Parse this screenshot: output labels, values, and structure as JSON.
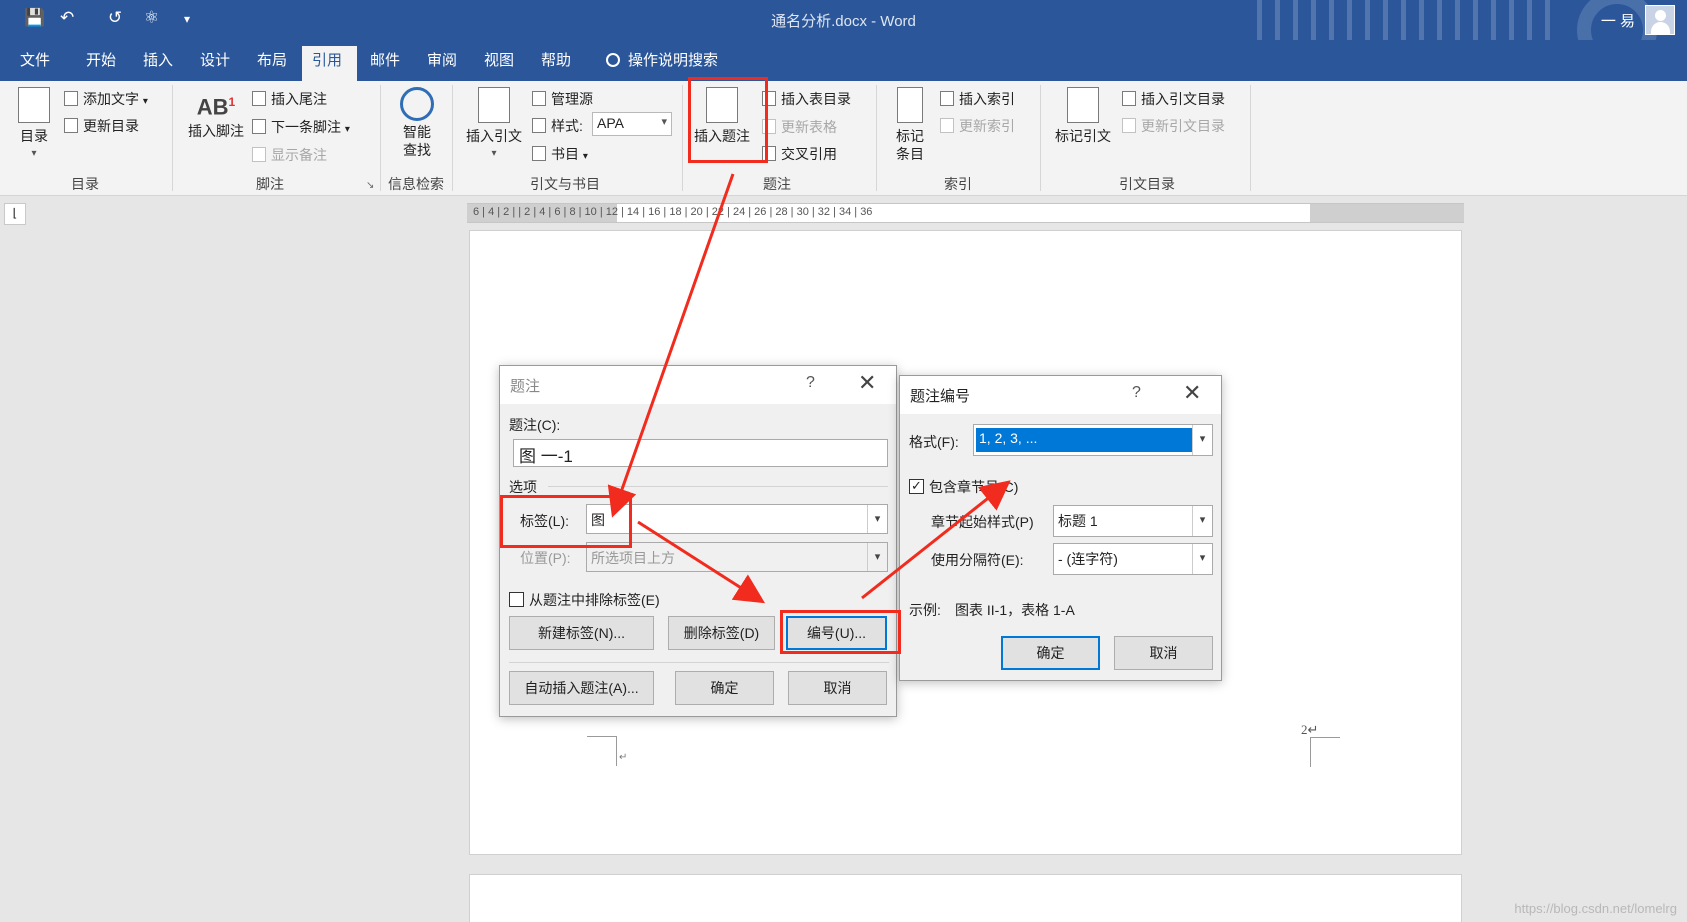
{
  "window": {
    "title": "通名分析.docx  -  Word",
    "user": "一 易",
    "qat": [
      "save-icon",
      "undo-icon",
      "redo-icon",
      "org-chart-icon",
      "customize-icon"
    ]
  },
  "tabs": [
    "文件",
    "开始",
    "插入",
    "设计",
    "布局",
    "引用",
    "邮件",
    "审阅",
    "视图",
    "帮助",
    "操作说明搜索"
  ],
  "active_tab": "引用",
  "ribbon": {
    "toc": {
      "big": "目录",
      "add_text": "添加文字",
      "update": "更新目录",
      "group": "目录"
    },
    "footnote": {
      "insert_footnote": "插入脚注",
      "insert_endnote": "插入尾注",
      "next_footnote": "下一条脚注",
      "show_notes": "显示备注",
      "group": "脚注"
    },
    "research": {
      "smart_lookup_1": "智能",
      "smart_lookup_2": "查找",
      "group": "信息检索"
    },
    "citations": {
      "insert_citation": "插入引文",
      "manage_sources": "管理源",
      "style_label": "样式:",
      "style_value": "APA",
      "bibliography": "书目",
      "group": "引文与书目"
    },
    "captions": {
      "insert_caption": "插入题注",
      "insert_table_of_figures": "插入表目录",
      "update_table": "更新表格",
      "cross_reference": "交叉引用",
      "group": "题注"
    },
    "index": {
      "mark_entry_1": "标记",
      "mark_entry_2": "条目",
      "insert_index": "插入索引",
      "update_index": "更新索引",
      "group": "索引"
    },
    "toa": {
      "mark_citation": "标记引文",
      "insert_toa": "插入引文目录",
      "update_toa": "更新引文目录",
      "group": "引文目录"
    }
  },
  "ruler": {
    "ticks": "6 | 4 | 2 |  | 2 | 4 | 6 | 8 | 10 | 12 | 14 | 16 | 18 | 20 | 22 | 24 | 26 | 28 | 30 | 32 | 34 | 36"
  },
  "document": {
    "page_number": "2↵",
    "para_mark": "↵",
    "watermark": "https://blog.csdn.net/lomelrg"
  },
  "caption_dialog": {
    "title": "题注",
    "help": "?",
    "close": "✕",
    "caption_label": "题注(C):",
    "caption_value": "图 一-1",
    "options_label": "选项",
    "label_label": "标签(L):",
    "label_value": "图",
    "position_label": "位置(P):",
    "position_value": "所选项目上方",
    "exclude_label": "从题注中排除标签(E)",
    "new_label_btn": "新建标签(N)...",
    "delete_label_btn": "删除标签(D)",
    "numbering_btn": "编号(U)...",
    "autocaption_btn": "自动插入题注(A)...",
    "ok_btn": "确定",
    "cancel_btn": "取消"
  },
  "numbering_dialog": {
    "title": "题注编号",
    "help": "?",
    "close": "✕",
    "format_label": "格式(F):",
    "format_value": "1, 2, 3, ...",
    "include_chapter_label": "包含章节号(C)",
    "include_chapter_checked": true,
    "chapter_style_label": "章节起始样式(P)",
    "chapter_style_value": "标题 1",
    "separator_label": "使用分隔符(E):",
    "separator_value": "-     (连字符)",
    "example_label": "示例:",
    "example_value": "图表 II-1，表格 1-A",
    "ok_btn": "确定",
    "cancel_btn": "取消"
  },
  "annotation_color": "#f12b1d",
  "accent_color": "#2b579a"
}
